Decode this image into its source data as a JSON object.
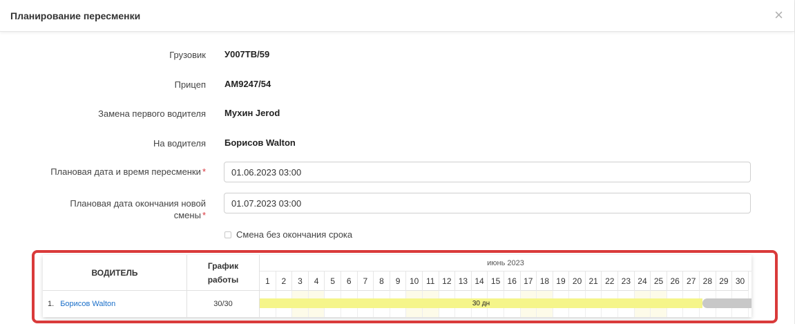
{
  "dialog": {
    "title": "Планирование пересменки",
    "close_icon": "×"
  },
  "fields": {
    "truck_label": "Грузовик",
    "truck_value": "У007ТВ/59",
    "trailer_label": "Прицеп",
    "trailer_value": "АМ9247/54",
    "replace_label": "Замена первого водителя",
    "replace_value": "Мухин Jerod",
    "to_driver_label": "На водителя",
    "to_driver_value": "Борисов Walton",
    "planned_start_label": "Плановая дата и время пересменки",
    "planned_start_value": "01.06.2023 03:00",
    "planned_end_label_line1": "Плановая дата окончания новой",
    "planned_end_label_line2": "смены",
    "planned_end_value": "01.07.2023 03:00",
    "required_mark": "*",
    "no_end_checkbox_label": "Смена без окончания срока",
    "no_end_checked": false
  },
  "schedule": {
    "driver_header": "ВОДИТЕЛЬ",
    "schedule_header_line1": "График",
    "schedule_header_line2": "работы",
    "month_label": "июнь 2023",
    "days": [
      "1",
      "2",
      "3",
      "4",
      "5",
      "6",
      "7",
      "8",
      "9",
      "10",
      "11",
      "12",
      "13",
      "14",
      "15",
      "16",
      "17",
      "18",
      "19",
      "20",
      "21",
      "22",
      "23",
      "24",
      "25",
      "26",
      "27",
      "28",
      "29",
      "30"
    ],
    "rows": [
      {
        "num": "1.",
        "driver": "Борисов Walton",
        "schedule": "30/30",
        "bar_label": "30 дн"
      }
    ]
  },
  "colors": {
    "highlight_border": "#d93a3a",
    "link": "#1a6fc9",
    "bar_work": "#f5f58a",
    "bar_rest": "#c8c8c8",
    "required": "#d9363e"
  }
}
